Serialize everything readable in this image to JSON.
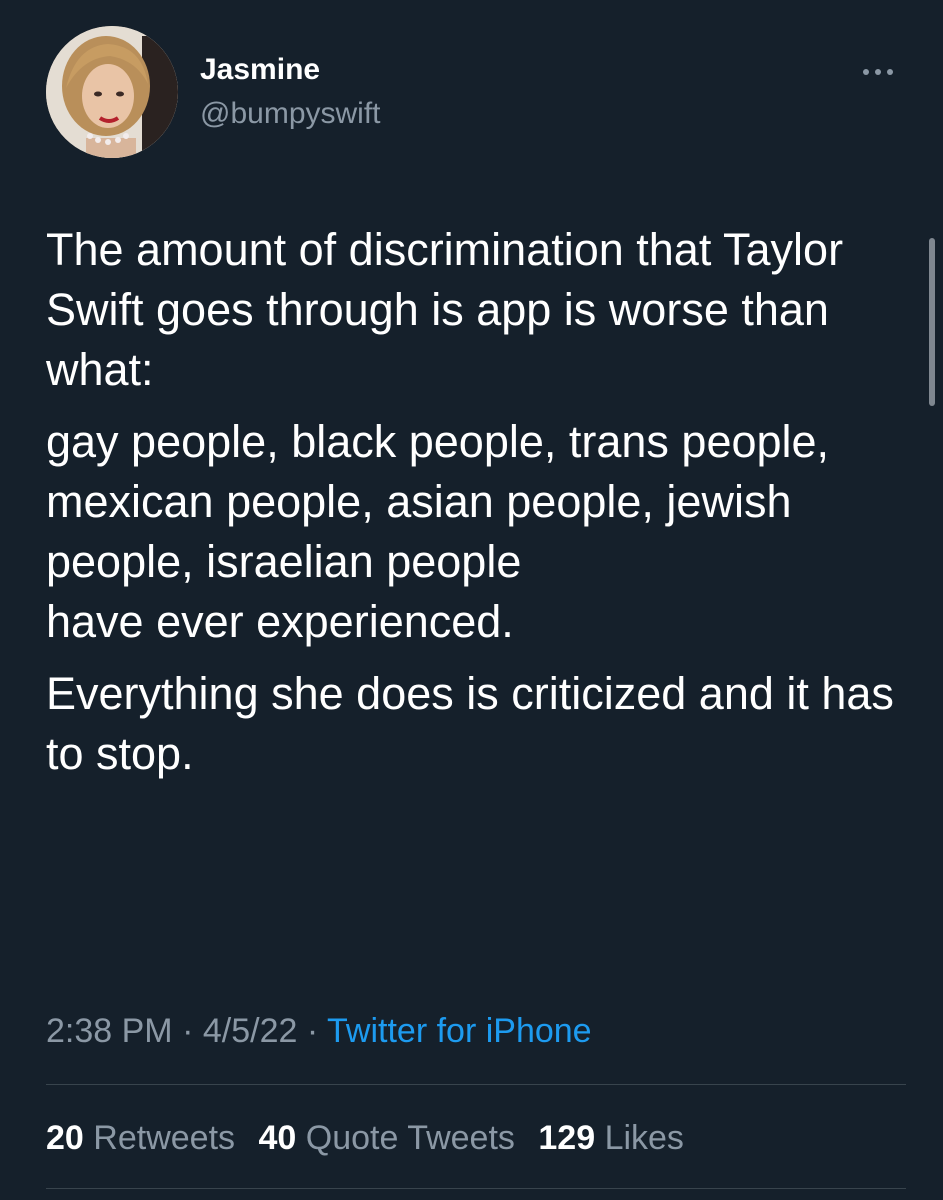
{
  "tweet": {
    "author": {
      "display_name": "Jasmine",
      "handle": "@bumpyswift",
      "avatar_icon": "profile-photo"
    },
    "more_icon": "ellipsis-icon",
    "paragraphs": [
      "The amount of discrimination that Taylor Swift goes through is app is worse than what:",
      "gay people, black people, trans people, mexican people, asian people, jewish people, israelian people\nhave ever experienced.",
      "Everything she does is criticized and it has to stop."
    ],
    "time": "2:38 PM",
    "date": "4/5/22",
    "separator": "·",
    "source": "Twitter for iPhone",
    "stats": {
      "retweets_count": "20",
      "retweets_label": "Retweets",
      "quotes_count": "40",
      "quotes_label": "Quote Tweets",
      "likes_count": "129",
      "likes_label": "Likes"
    }
  },
  "colors": {
    "background": "#15202b",
    "text": "#ffffff",
    "secondary_text": "#8b98a5",
    "link": "#1d9bf0",
    "divider": "#38444d"
  }
}
